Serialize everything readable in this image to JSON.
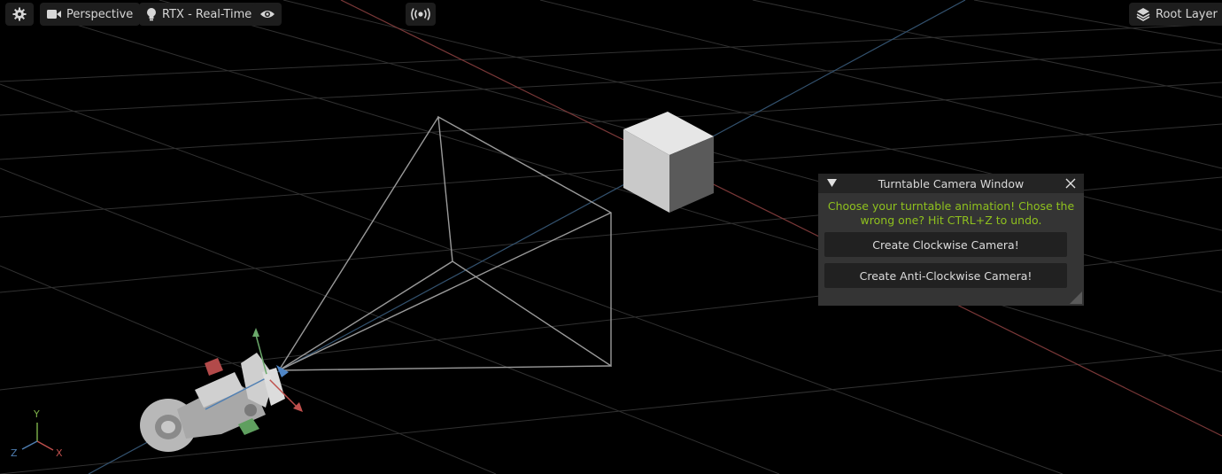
{
  "toolbar": {
    "settings_icon": "gear-icon",
    "camera_label": "Perspective",
    "camera_icon": "video-camera-icon",
    "render_label": "RTX - Real-Time",
    "render_icon": "lightbulb-icon",
    "visibility_icon": "eye-icon",
    "live_icon": "broadcast-icon",
    "layer_label": "Root Layer",
    "layer_icon": "layers-icon"
  },
  "turntable_window": {
    "title": "Turntable Camera Window",
    "message": "Choose your turntable animation! Chose the wrong one? Hit CTRL+Z to undo.",
    "clockwise_button": "Create Clockwise Camera!",
    "anticlockwise_button": "Create Anti-Clockwise Camera!",
    "message_color": "#8fc11e"
  },
  "axis_gizmo": {
    "y": "Y",
    "z": "Z",
    "x": "X",
    "colors": {
      "x": "#c0504d",
      "y": "#7fb34a",
      "z": "#4f7fb3"
    }
  }
}
